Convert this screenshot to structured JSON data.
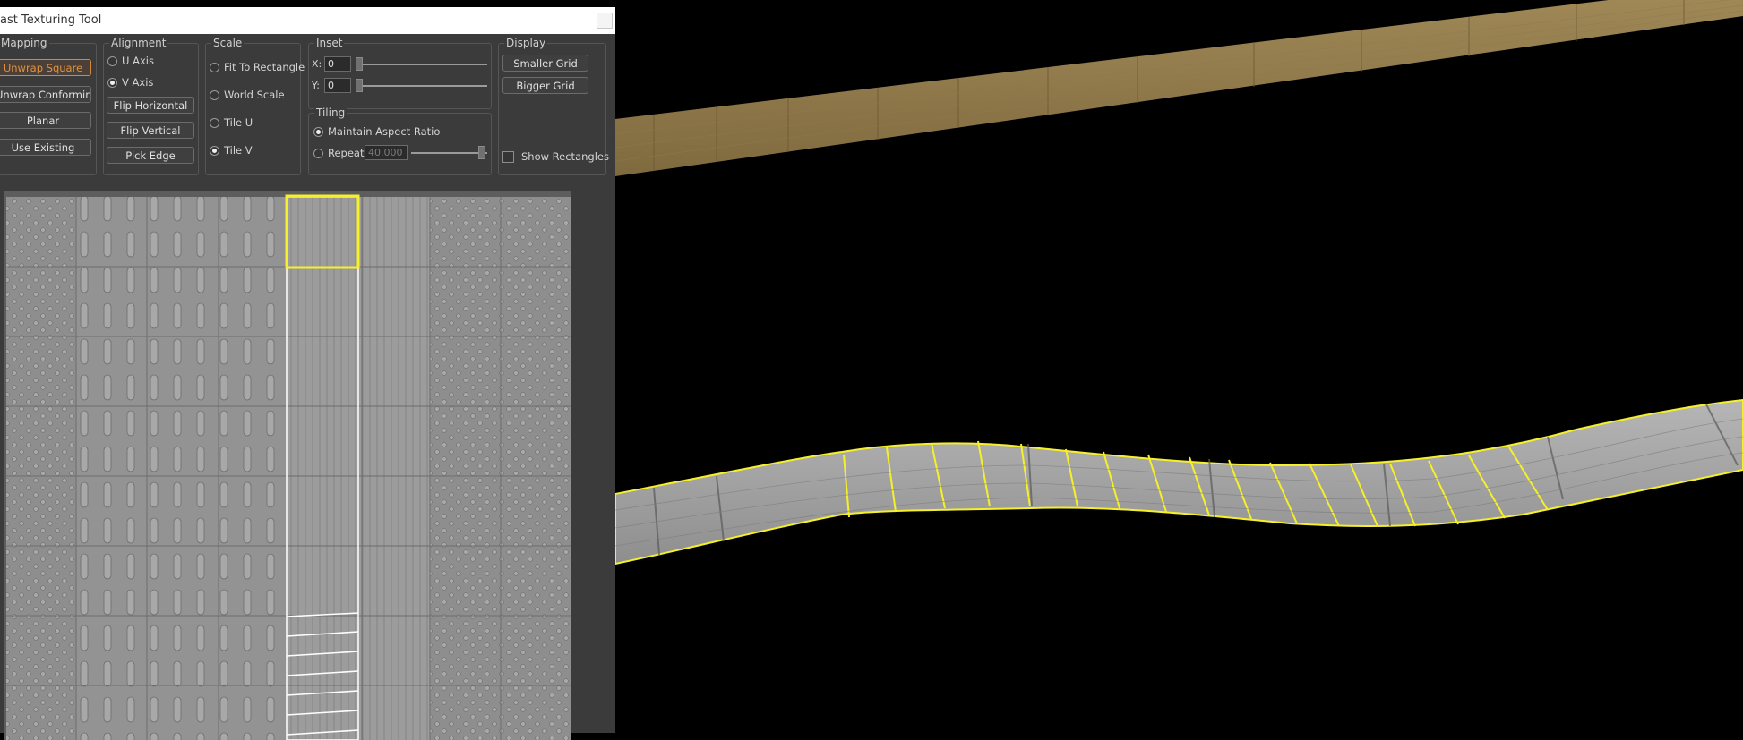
{
  "window": {
    "title": "ast Texturing Tool"
  },
  "mapping": {
    "title": "Mapping",
    "buttons": [
      "Unwrap Square",
      "Unwrap Conforming",
      "Planar",
      "Use Existing"
    ],
    "active_index": 0
  },
  "alignment": {
    "title": "Alignment",
    "radios": [
      {
        "label": "U Axis",
        "checked": false
      },
      {
        "label": "V Axis",
        "checked": true
      }
    ],
    "buttons": [
      "Flip Horizontal",
      "Flip Vertical",
      "Pick Edge"
    ]
  },
  "scale": {
    "title": "Scale",
    "radios": [
      {
        "label": "Fit To Rectangle",
        "checked": false
      },
      {
        "label": "World Scale",
        "checked": false
      },
      {
        "label": "Tile U",
        "checked": false
      },
      {
        "label": "Tile V",
        "checked": true
      }
    ]
  },
  "inset": {
    "title": "Inset",
    "x_label": "X:",
    "x_value": "0",
    "y_label": "Y:",
    "y_value": "0",
    "x_slider_fraction": 0.0,
    "y_slider_fraction": 0.0
  },
  "tiling": {
    "title": "Tiling",
    "maintain_label": "Maintain Aspect Ratio",
    "maintain_checked": true,
    "repeat_label": "Repeat",
    "repeat_checked": false,
    "repeat_value": "40.000",
    "repeat_slider_fraction": 1.0
  },
  "display": {
    "title": "Display",
    "smaller_grid": "Smaller Grid",
    "bigger_grid": "Bigger Grid",
    "show_rectangles_label": "Show Rectangles",
    "show_rectangles_checked": false
  },
  "colors": {
    "panel_bg": "#3b3b3b",
    "active_button": "#e2913e",
    "selection_yellow": "#f5f02a",
    "viewport_bg": "#000000"
  }
}
